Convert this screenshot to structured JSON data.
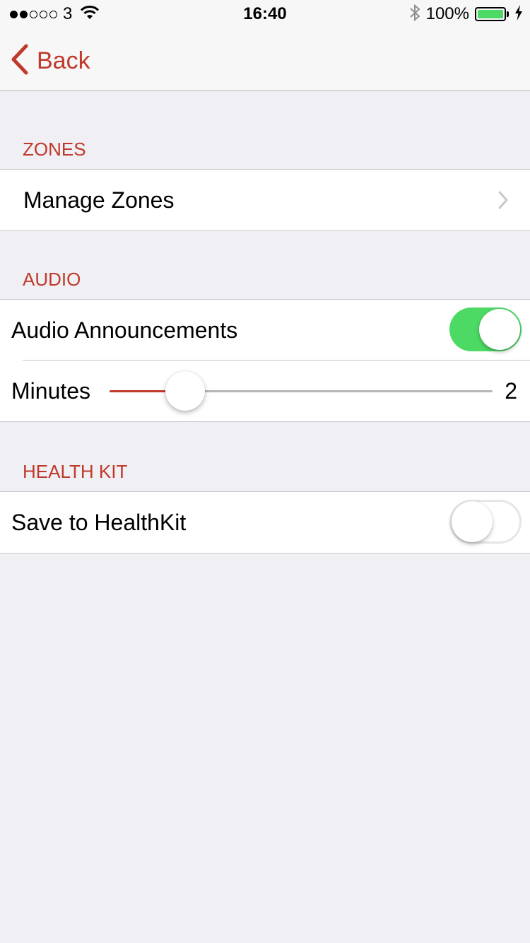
{
  "status_bar": {
    "signal_total": 5,
    "signal_filled": 2,
    "carrier": "3",
    "time": "16:40",
    "battery_percent": "100%",
    "battery_level": 1.0
  },
  "nav": {
    "back_label": "Back"
  },
  "sections": {
    "zones": {
      "header": "ZONES",
      "manage_label": "Manage Zones"
    },
    "audio": {
      "header": "AUDIO",
      "announcements_label": "Audio Announcements",
      "announcements_on": true,
      "minutes_label": "Minutes",
      "minutes_value": "2",
      "minutes_slider_fraction": 0.15
    },
    "health_kit": {
      "header": "HEALTH KIT",
      "save_label": "Save to HealthKit",
      "save_on": false
    }
  },
  "colors": {
    "accent": "#c0392b",
    "toggle_on": "#4cd964",
    "background": "#efeff4"
  }
}
